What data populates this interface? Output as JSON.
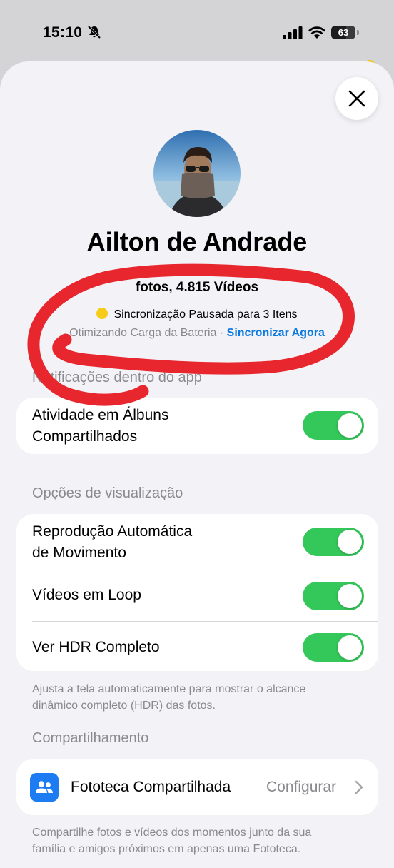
{
  "status_bar": {
    "time": "15:10",
    "battery": "63",
    "battery_level": 0.63
  },
  "colors": {
    "accent": "#0a7ae0",
    "toggle_on": "#34c759",
    "sync_dot": "#f7cc18",
    "scribble": "#e8262e"
  },
  "profile": {
    "name": "Ailton de Andrade",
    "counts_text": "fotos, 4.815 Vídeos",
    "sync_status": "Sincronização Pausada para 3 Itens",
    "sync_reason": "Otimizando Carga da Bateria · ",
    "sync_now": "Sincronizar Agora"
  },
  "notifications": {
    "header": "Notificações dentro do app",
    "shared_album_activity": {
      "label_line1": "Atividade em Álbuns",
      "label_line2": "Compartilhados",
      "on": true
    }
  },
  "view_options": {
    "header": "Opções de visualização",
    "autoplay": {
      "label_line1": "Reprodução Automática",
      "label_line2": "de Movimento",
      "on": true
    },
    "loop_videos": {
      "label": "Vídeos em Loop",
      "on": true
    },
    "full_hdr": {
      "label": "Ver HDR Completo",
      "on": true
    },
    "footer_line1": "Ajusta a tela automaticamente para mostrar o alcance",
    "footer_line2": "dinâmico completo (HDR) das fotos."
  },
  "sharing": {
    "header": "Compartilhamento",
    "shared_library": {
      "label": "Fototeca Compartilhada",
      "value": "Configurar",
      "icon": "people-icon"
    },
    "footer_line1": "Compartilhe fotos e vídeos dos momentos junto da sua",
    "footer_line2": "família e amigos próximos em apenas uma Fototeca."
  }
}
